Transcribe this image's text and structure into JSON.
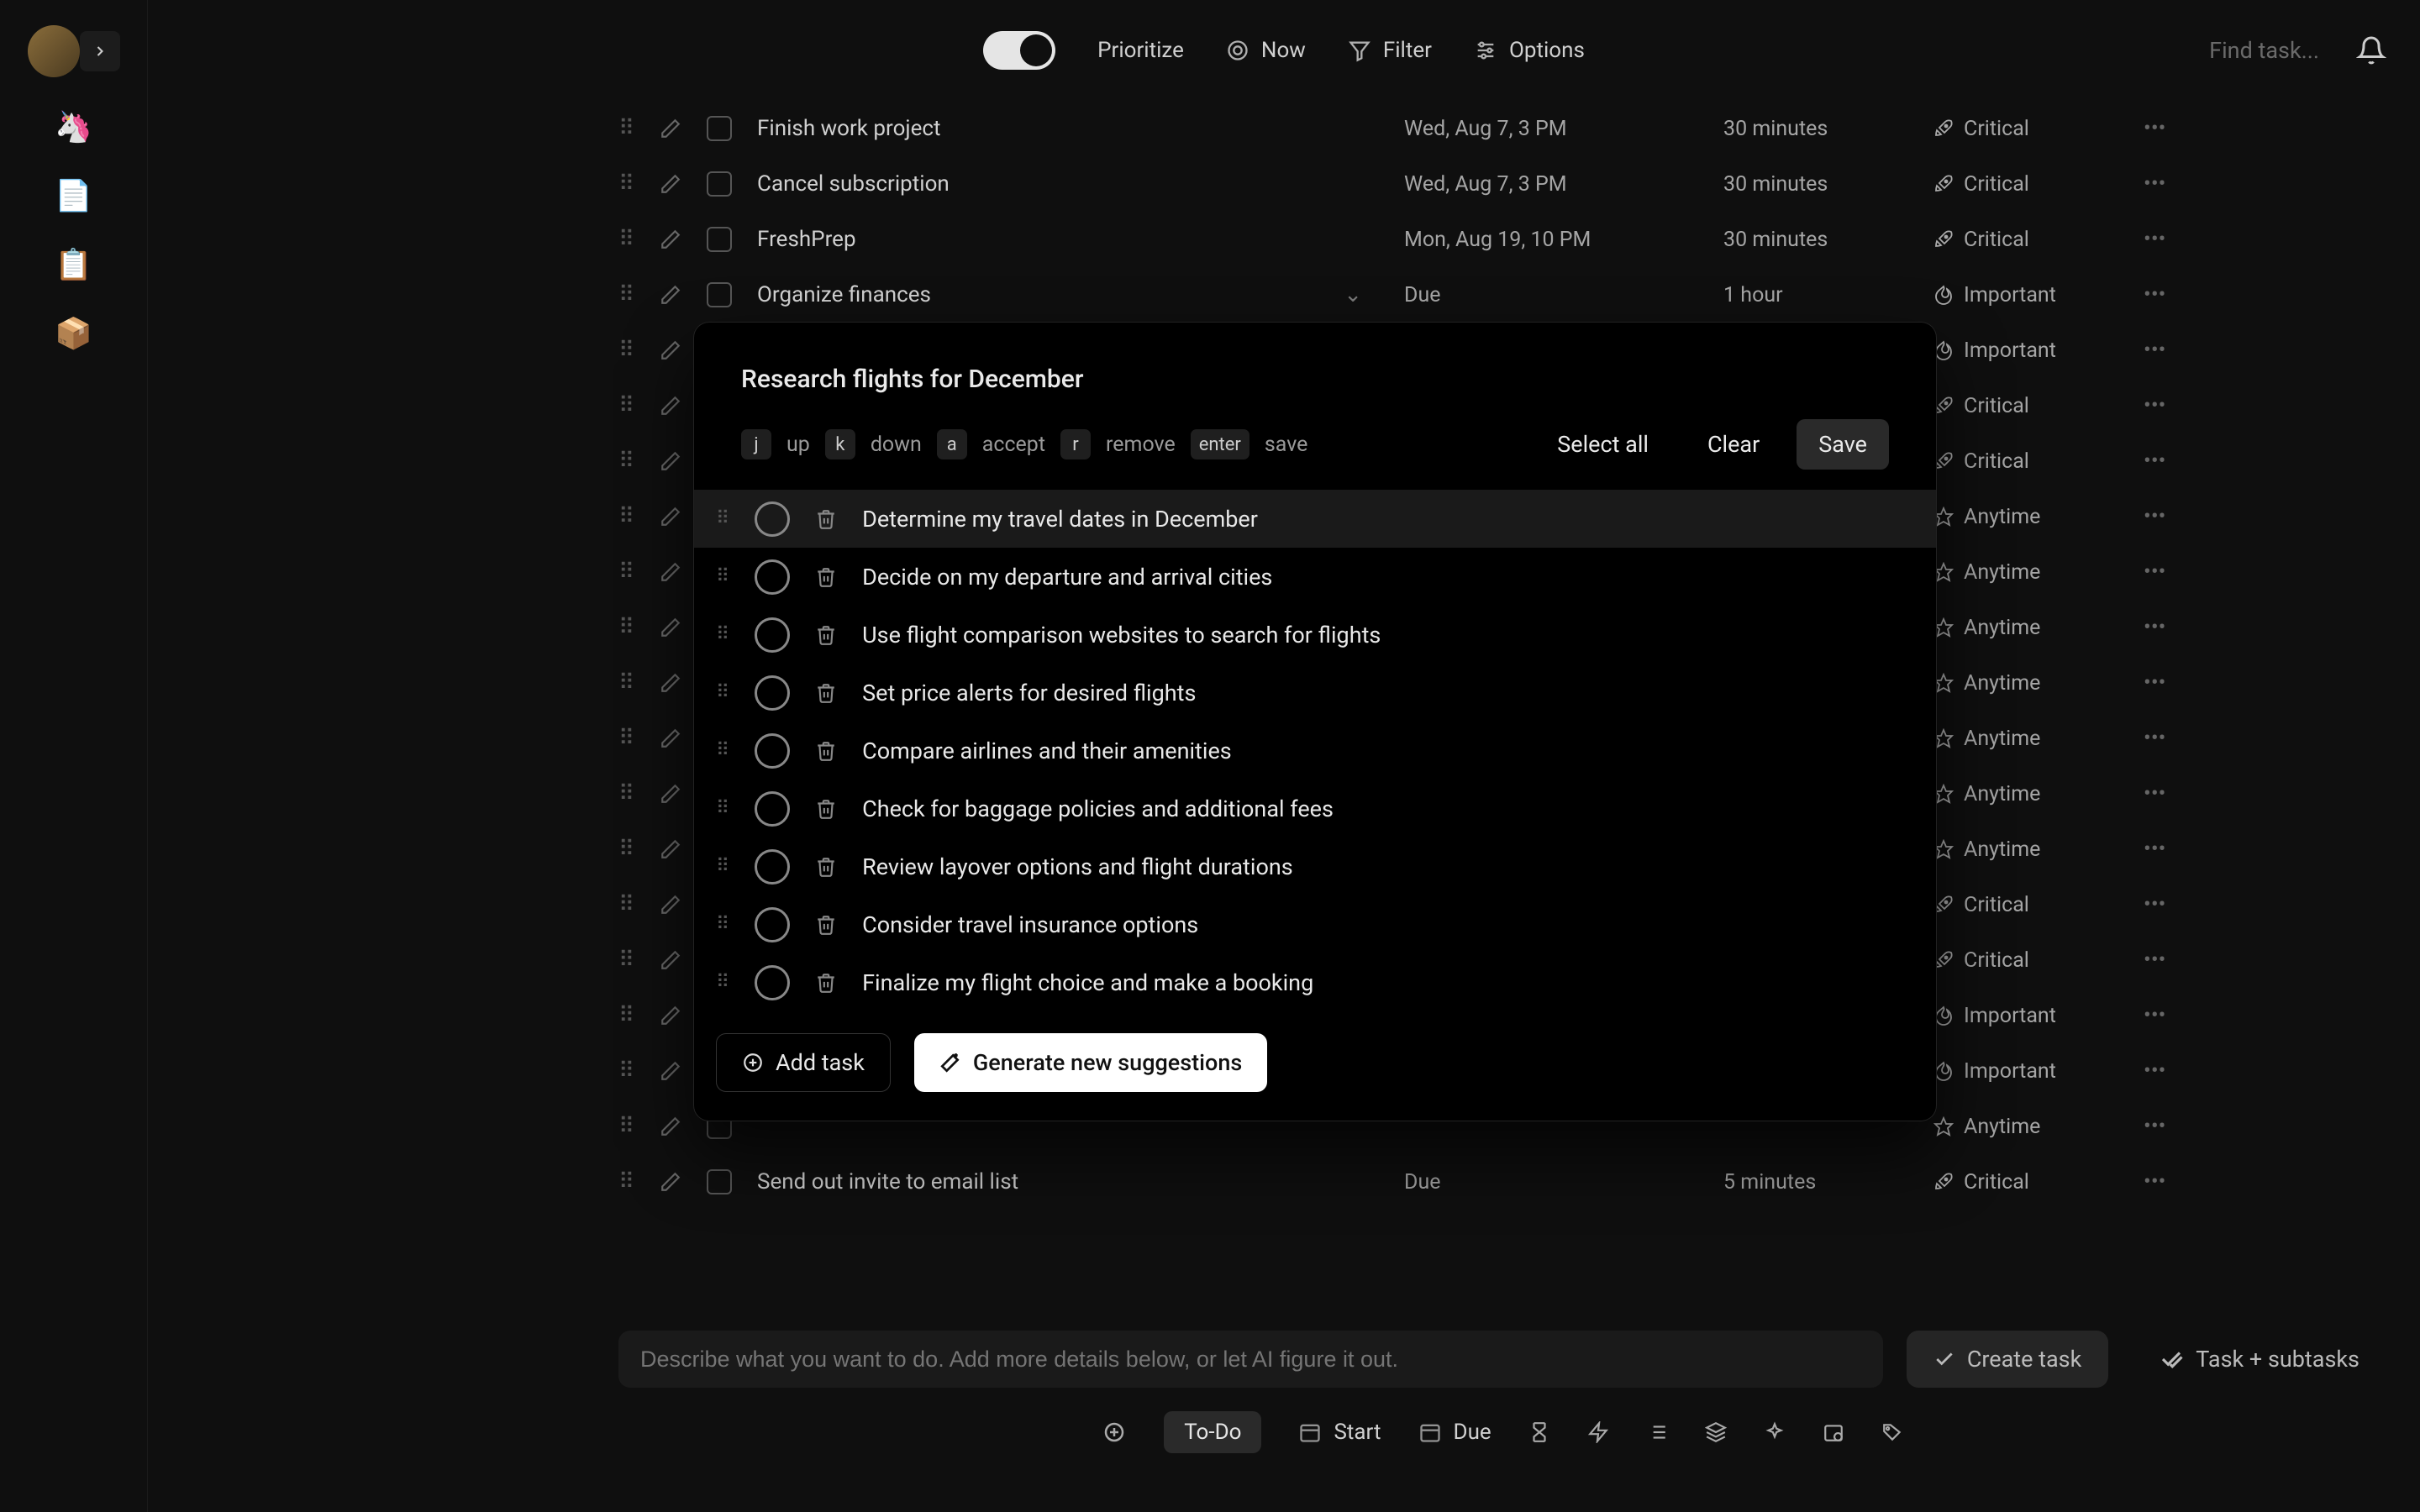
{
  "topbar": {
    "prioritize": "Prioritize",
    "now": "Now",
    "filter": "Filter",
    "options": "Options",
    "search_placeholder": "Find task..."
  },
  "tasks": [
    {
      "title": "Finish work project",
      "date": "Wed, Aug 7, 3 PM",
      "dur": "30 minutes",
      "prio": "Critical",
      "icon": "rocket"
    },
    {
      "title": "Cancel subscription",
      "date": "Wed, Aug 7, 3 PM",
      "dur": "30 minutes",
      "prio": "Critical",
      "icon": "rocket"
    },
    {
      "title": "FreshPrep",
      "date": "Mon, Aug 19, 10 PM",
      "dur": "30 minutes",
      "prio": "Critical",
      "icon": "rocket"
    },
    {
      "title": "Organize finances",
      "date": "Due",
      "dur": "1 hour",
      "prio": "Important",
      "icon": "flame",
      "chev": true
    },
    {
      "title": "",
      "date": "",
      "dur": "",
      "prio": "Important",
      "icon": "flame"
    },
    {
      "title": "",
      "date": "",
      "dur": "",
      "prio": "Critical",
      "icon": "rocket"
    },
    {
      "title": "",
      "date": "",
      "dur": "",
      "prio": "Critical",
      "icon": "rocket"
    },
    {
      "title": "",
      "date": "",
      "dur": "",
      "prio": "Anytime",
      "icon": "star"
    },
    {
      "title": "",
      "date": "",
      "dur": "",
      "prio": "Anytime",
      "icon": "star"
    },
    {
      "title": "",
      "date": "",
      "dur": "",
      "prio": "Anytime",
      "icon": "star"
    },
    {
      "title": "",
      "date": "",
      "dur": "",
      "prio": "Anytime",
      "icon": "star"
    },
    {
      "title": "",
      "date": "",
      "dur": "",
      "prio": "Anytime",
      "icon": "star"
    },
    {
      "title": "",
      "date": "",
      "dur": "",
      "prio": "Anytime",
      "icon": "star"
    },
    {
      "title": "",
      "date": "",
      "dur": "",
      "prio": "Anytime",
      "icon": "star"
    },
    {
      "title": "",
      "date": "",
      "dur": "",
      "prio": "Critical",
      "icon": "rocket"
    },
    {
      "title": "",
      "date": "",
      "dur": "",
      "prio": "Critical",
      "icon": "rocket"
    },
    {
      "title": "",
      "date": "",
      "dur": "",
      "prio": "Important",
      "icon": "flame"
    },
    {
      "title": "",
      "date": "",
      "dur": "",
      "prio": "Important",
      "icon": "flame"
    },
    {
      "title": "",
      "date": "",
      "dur": "",
      "prio": "Anytime",
      "icon": "star"
    },
    {
      "title": "Send out invite to email list",
      "date": "Due",
      "dur": "5 minutes",
      "prio": "Critical",
      "icon": "rocket"
    }
  ],
  "modal": {
    "title": "Research flights for December",
    "hints": {
      "j": "j",
      "up": "up",
      "k": "k",
      "down": "down",
      "a": "a",
      "accept": "accept",
      "r": "r",
      "remove": "remove",
      "enter": "enter",
      "save": "save"
    },
    "select_all": "Select all",
    "clear": "Clear",
    "save_btn": "Save",
    "items": [
      "Determine my travel dates in December",
      "Decide on my departure and arrival cities",
      "Use flight comparison websites to search for flights",
      "Set price alerts for desired flights",
      "Compare airlines and their amenities",
      "Check for baggage policies and additional fees",
      "Review layover options and flight durations",
      "Consider travel insurance options",
      "Finalize my flight choice and make a booking"
    ],
    "add_task": "Add task",
    "generate": "Generate new suggestions"
  },
  "compose": {
    "placeholder": "Describe what you want to do. Add more details below, or let AI figure it out.",
    "create": "Create task",
    "task_subtasks": "Task + subtasks"
  },
  "actionbar": {
    "status": "To-Do",
    "start": "Start",
    "due": "Due"
  }
}
